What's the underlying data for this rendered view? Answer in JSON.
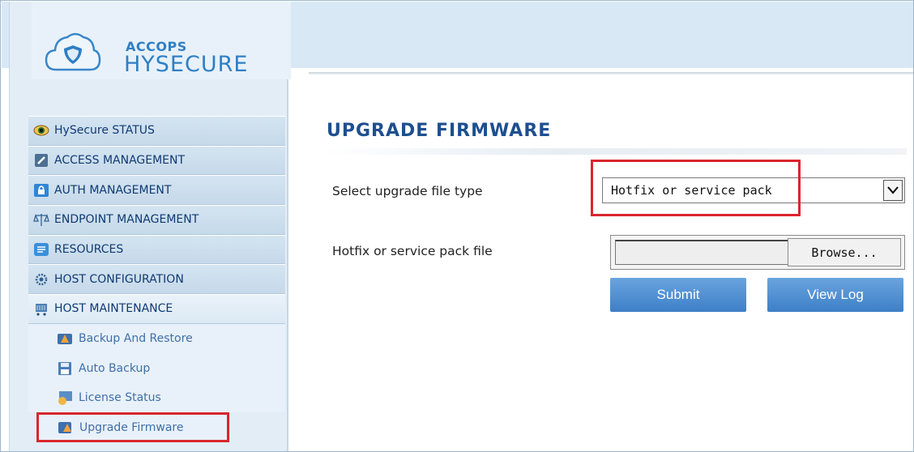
{
  "brand": {
    "top": "ACCOPS",
    "main": "HYSECURE"
  },
  "nav": {
    "items": [
      {
        "label": "HySecure STATUS",
        "icon": "eye-icon"
      },
      {
        "label": "ACCESS MANAGEMENT",
        "icon": "shield-icon"
      },
      {
        "label": "AUTH MANAGEMENT",
        "icon": "lock-icon"
      },
      {
        "label": "ENDPOINT MANAGEMENT",
        "icon": "scale-icon"
      },
      {
        "label": "RESOURCES",
        "icon": "resources-icon"
      },
      {
        "label": "HOST CONFIGURATION",
        "icon": "gears-icon"
      },
      {
        "label": "HOST MAINTENANCE",
        "icon": "cart-icon"
      }
    ],
    "subitems": [
      {
        "label": "Backup And Restore",
        "icon": "backup-icon"
      },
      {
        "label": "Auto Backup",
        "icon": "disk-icon"
      },
      {
        "label": "License Status",
        "icon": "license-icon"
      },
      {
        "label": "Upgrade Firmware",
        "icon": "upgrade-icon"
      }
    ]
  },
  "main": {
    "title": "UPGRADE FIRMWARE",
    "file_type_label": "Select upgrade file type",
    "file_type_value": "Hotfix or service pack",
    "file_label": "Hotfix or service pack file",
    "browse_label": "Browse...",
    "submit_label": "Submit",
    "view_log_label": "View Log"
  },
  "colors": {
    "accent": "#2f7fc4",
    "nav_text": "#0f3a73",
    "highlight": "#d9262c",
    "button": "#4a8bd0"
  }
}
